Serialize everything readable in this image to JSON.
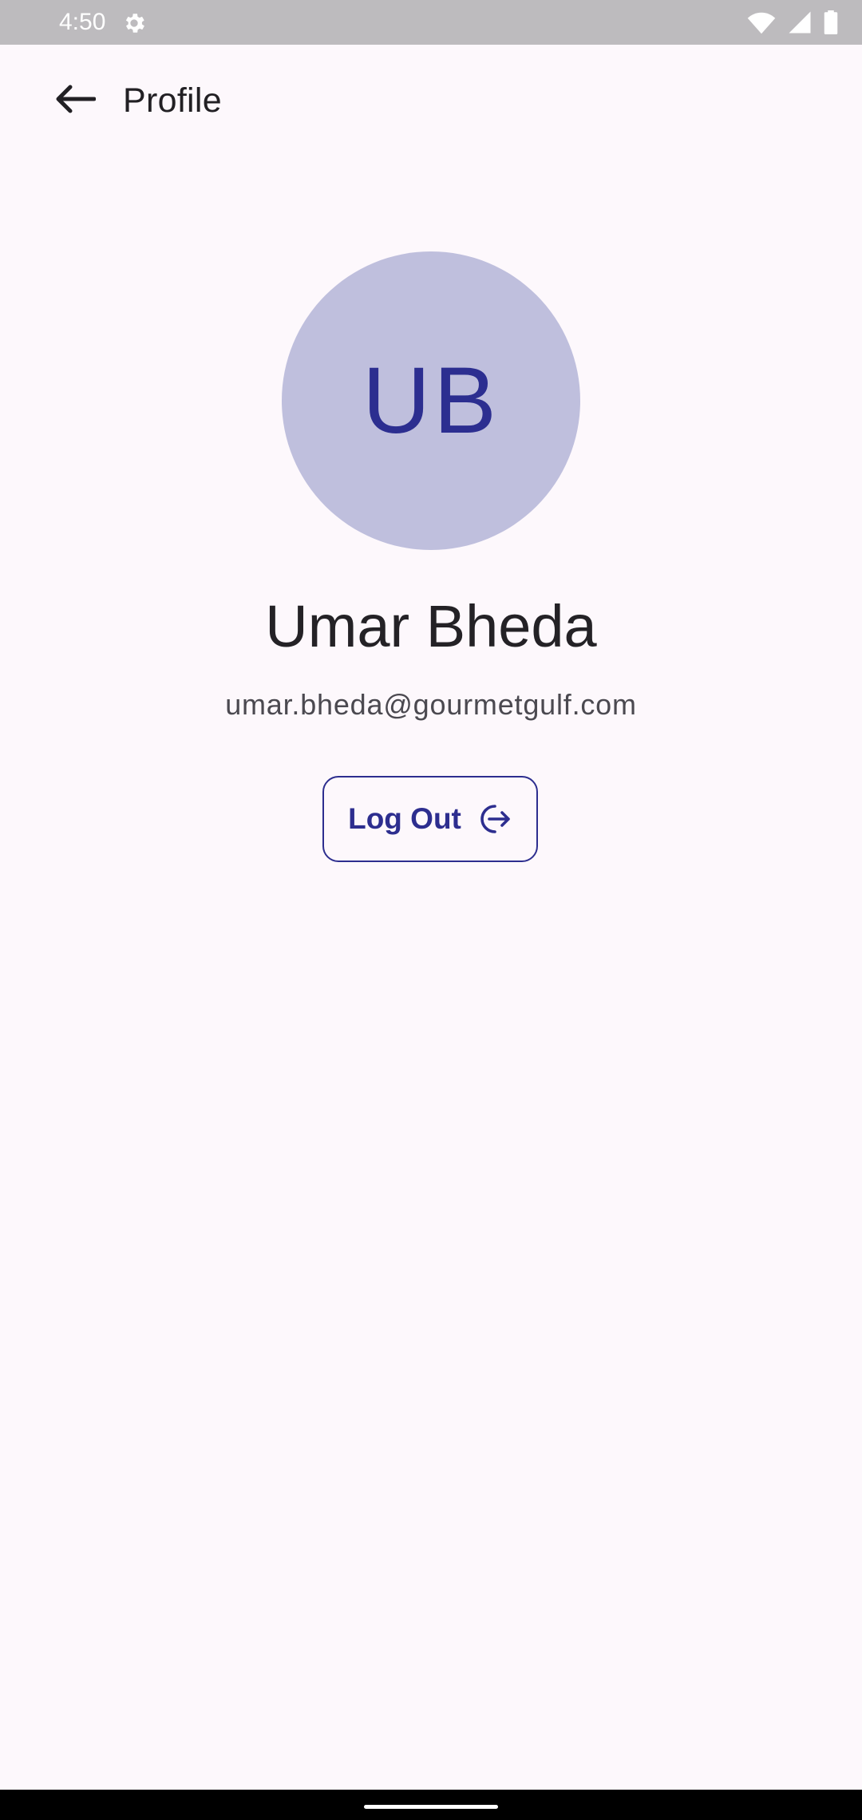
{
  "status_bar": {
    "time": "4:50",
    "icons": [
      "gear-icon",
      "wifi-icon",
      "cellular-signal-icon",
      "battery-icon"
    ]
  },
  "app_bar": {
    "back_icon": "arrow-left-icon",
    "title": "Profile"
  },
  "profile": {
    "initials": "UB",
    "name": "Umar Bheda",
    "email": "umar.bheda@gourmetgulf.com"
  },
  "actions": {
    "logout_label": "Log Out",
    "logout_icon": "logout-icon"
  },
  "colors": {
    "accent": "#2d2e8f",
    "avatar_bg": "#bfbfdd",
    "background": "#fdf8fc",
    "status_bar_bg": "#bdbbbe"
  }
}
